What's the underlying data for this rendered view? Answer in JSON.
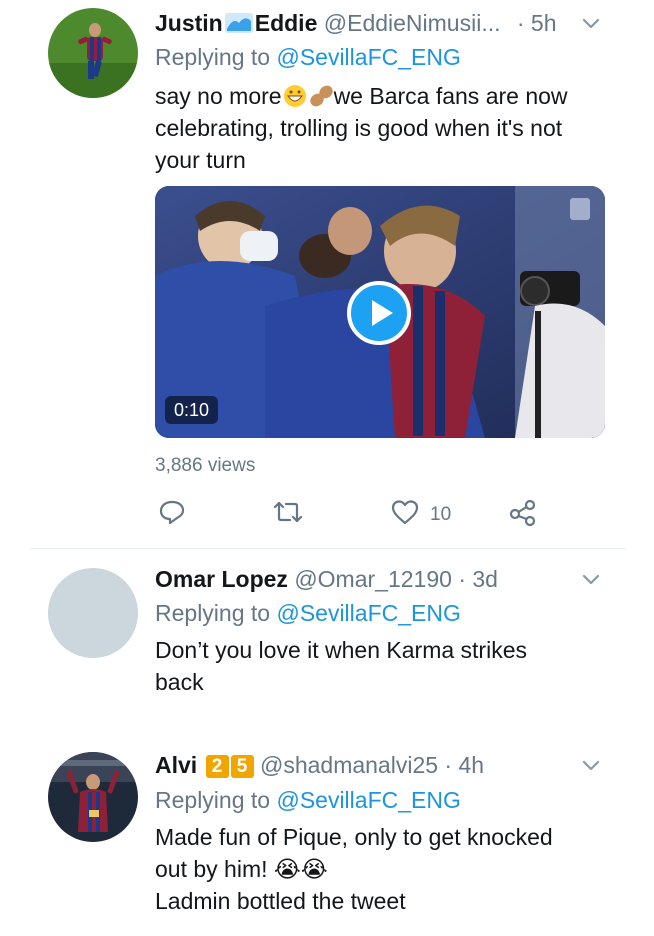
{
  "tweets": [
    {
      "display_name_first": "Justin",
      "display_name_second": "Eddie",
      "handle": "@EddieNimusii...",
      "time": "· 5h",
      "replying_prefix": "Replying to ",
      "replying_to": "@SevillaFC_ENG",
      "text_part1": "say no more",
      "text_part2": "we Barca fans are now",
      "text_line2": "celebrating, trolling is good when it's not",
      "text_line3": "your turn",
      "video_duration": "0:10",
      "views": "3,886 views",
      "like_count": "10"
    },
    {
      "display_name": "Omar Lopez",
      "handle": "@Omar_12190",
      "time": "· 3d",
      "replying_prefix": "Replying to ",
      "replying_to": "@SevillaFC_ENG",
      "text_line1": "Don’t you love it when Karma strikes",
      "text_line2": "back"
    },
    {
      "display_name": "Alvi",
      "badges": [
        "2",
        "5"
      ],
      "handle": "@shadmanalvi25",
      "time": "· 4h",
      "replying_prefix": "Replying to ",
      "replying_to": "@SevillaFC_ENG",
      "text_line1": "Made fun of Pique, only to get knocked",
      "text_line2": "out by him! 😭😭",
      "text_line3": "Ladmin bottled the tweet"
    }
  ],
  "icons": {
    "reply": "reply-icon",
    "retweet": "retweet-icon",
    "like": "heart-icon",
    "share": "share-icon",
    "more": "chevron-down-icon",
    "play": "play-icon"
  },
  "colors": {
    "link": "#1b95e0",
    "muted": "#657786",
    "play": "#1da1f2"
  }
}
